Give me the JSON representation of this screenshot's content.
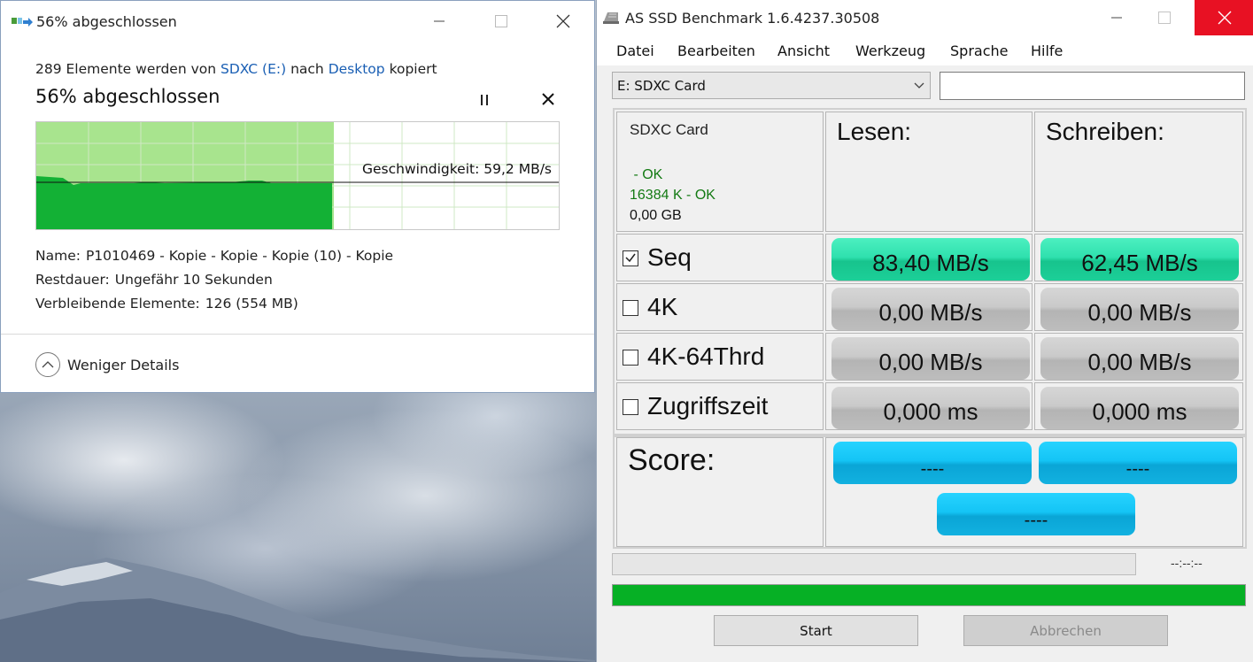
{
  "copy_dialog": {
    "title": "56% abgeschlossen",
    "info_prefix": "289 Elemente werden von",
    "source": "SDXC (E:)",
    "info_mid": "nach",
    "destination": "Desktop",
    "info_suffix": "kopiert",
    "heading": "56% abgeschlossen",
    "progress_percent": 56,
    "speed_label": "Geschwindigkeit: 59,2 MB/s",
    "name_label": "Name:",
    "name_value": "P1010469 - Kopie - Kopie - Kopie (10) - Kopie",
    "remaining_label": "Restdauer:",
    "remaining_value": "Ungefähr 10 Sekunden",
    "items_left_label": "Verbleibende Elemente:",
    "items_left_value": "126 (554 MB)",
    "less_details": "Weniger Details",
    "colors": {
      "graph_fill": "#13b135",
      "graph_bg": "#a8e48e",
      "link": "#1a5fb4"
    }
  },
  "ssd": {
    "title": "AS SSD Benchmark 1.6.4237.30508",
    "menu": [
      "Datei",
      "Bearbeiten",
      "Ansicht",
      "Werkzeug",
      "Sprache",
      "Hilfe"
    ],
    "drive_selected": "E: SDXC Card",
    "text_input_value": "",
    "drive_name": "SDXC Card",
    "ok1": " - OK",
    "ok2": "16384 K - OK",
    "size": "0,00 GB",
    "read_header": "Lesen:",
    "write_header": "Schreiben:",
    "rows": [
      {
        "label": "Seq",
        "checked": true,
        "read": "83,40 MB/s",
        "write": "62,45 MB/s"
      },
      {
        "label": "4K",
        "checked": false,
        "read": "0,00 MB/s",
        "write": "0,00 MB/s"
      },
      {
        "label": "4K-64Thrd",
        "checked": false,
        "read": "0,00 MB/s",
        "write": "0,00 MB/s"
      },
      {
        "label": "Zugriffszeit",
        "checked": false,
        "read": "0,000 ms",
        "write": "0,000 ms"
      }
    ],
    "score_label": "Score:",
    "score_read": "----",
    "score_write": "----",
    "score_total": "----",
    "time_label": "--:--:--",
    "start_button": "Start",
    "abort_button": "Abbrechen",
    "colors": {
      "pill_green": "#2fe0ae",
      "pill_gray": "#c6c6c6",
      "pill_blue": "#14c4f5",
      "close_red": "#e81123",
      "progress_green": "#06b025"
    }
  }
}
